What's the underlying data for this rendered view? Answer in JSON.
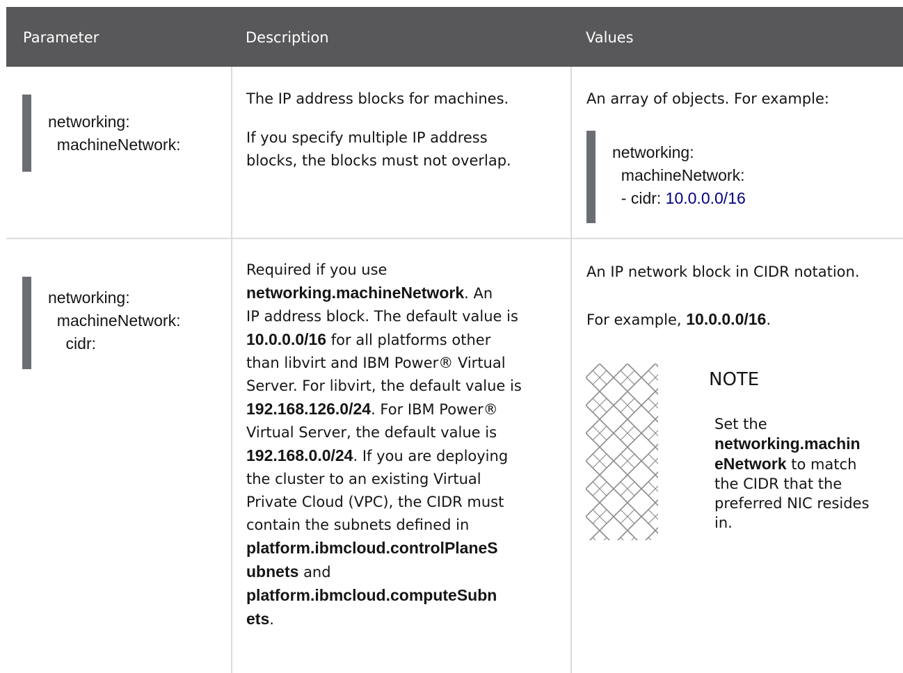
{
  "header": {
    "parameter": "Parameter",
    "description": "Description",
    "values": "Values"
  },
  "row1": {
    "param_line1": "networking:",
    "param_line2": "  machineNetwork:",
    "desc_p1": "The IP address blocks for machines.",
    "desc_p2_line1": "If you specify multiple IP address",
    "desc_p2_line2": "blocks, the blocks must not overlap.",
    "values_intro": "An array of objects. For example:",
    "code_line1": "networking:",
    "code_line2": "  machineNetwork:",
    "code_line3_prefix": "  - cidr: ",
    "code_line3_value": "10.0.0.0/16"
  },
  "row2": {
    "param_line1": "networking:",
    "param_line2": "  machineNetwork:",
    "param_line3": "    cidr:",
    "desc_lines": [
      {
        "text": "Required if you use",
        "bold": ""
      },
      {
        "bold": "networking.machineNetwork",
        "text": ". An"
      },
      {
        "text": "IP address block. The default value is",
        "bold": ""
      },
      {
        "bold": "10.0.0.0/16",
        "text": " for all platforms other"
      },
      {
        "text": "than libvirt and IBM Power® Virtual",
        "bold": ""
      },
      {
        "text": "Server. For libvirt, the default value is",
        "bold": ""
      },
      {
        "bold": "192.168.126.0/24",
        "text": ". For IBM Power®"
      },
      {
        "text": "Virtual Server, the default value is",
        "bold": ""
      },
      {
        "bold": "192.168.0.0/24",
        "text": ". If you are deploying"
      },
      {
        "text": "the cluster to an existing Virtual",
        "bold": ""
      },
      {
        "text": "Private Cloud (VPC), the CIDR must",
        "bold": ""
      },
      {
        "text": "contain the subnets defined in",
        "bold": ""
      },
      {
        "bold": "platform.ibmcloud.controlPlaneS",
        "text": ""
      },
      {
        "bold": "ubnets",
        "text": " and"
      },
      {
        "bold": "platform.ibmcloud.computeSubn",
        "text": ""
      },
      {
        "bold": "ets",
        "text": "."
      }
    ],
    "values_p1": "An IP network block in CIDR notation.",
    "values_p2_prefix": "For example, ",
    "values_p2_bold": "10.0.0.0/16",
    "values_p2_suffix": ".",
    "note": {
      "icon": "note-pattern-icon",
      "title": "NOTE",
      "line1": "Set the",
      "bold1": "networking.machin",
      "bold2": "eNetwork",
      "rest2": " to match",
      "line3": "the CIDR that the",
      "line4": "preferred NIC resides",
      "line5": "in."
    }
  },
  "colors": {
    "header_bg": "#58585a",
    "border": "#dcdcdc",
    "code_bar": "#6a6e73",
    "code_number": "#000080"
  }
}
